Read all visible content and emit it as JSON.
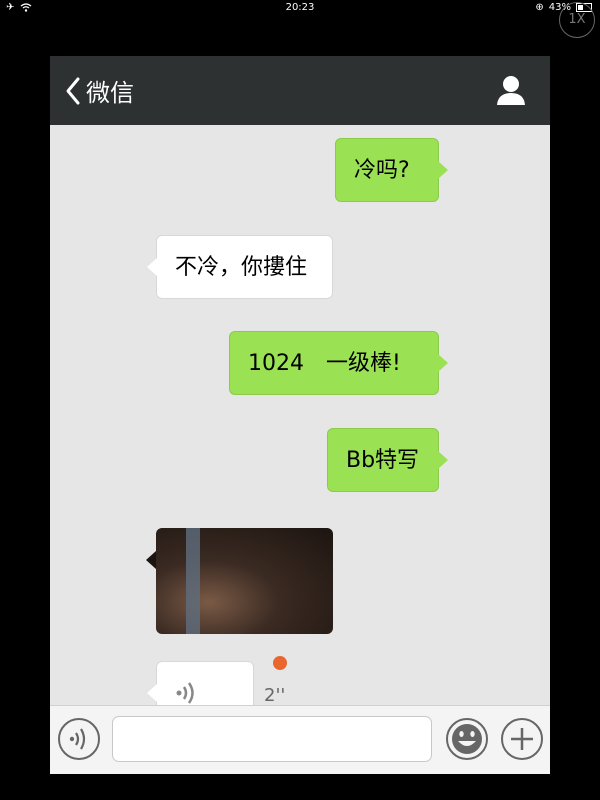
{
  "status_bar": {
    "time": "20:23",
    "battery": "43%",
    "airplane_icon": "airplane-icon",
    "wifi_icon": "wifi-icon",
    "orientation_lock_icon": "orientation-lock-icon",
    "zoom_badge": "1X"
  },
  "navbar": {
    "back_label": "微信",
    "back_icon": "chevron-left-icon",
    "profile_icon": "person-icon",
    "background": "#2e3132"
  },
  "messages": [
    {
      "direction": "outgoing",
      "text": "冷吗?"
    },
    {
      "direction": "incoming",
      "text": "不冷，你摟住"
    },
    {
      "direction": "outgoing",
      "text": "1024　一级棒!"
    },
    {
      "direction": "outgoing",
      "text": "Bb特写"
    },
    {
      "direction": "incoming",
      "type": "image"
    },
    {
      "direction": "incoming",
      "type": "voice",
      "duration": "2''",
      "unread": true
    }
  ],
  "colors": {
    "outgoing_bubble": "#9be154",
    "incoming_bubble": "#ffffff",
    "chat_background": "#e6e6e6",
    "unread_dot": "#e9662f"
  },
  "input_bar": {
    "voice_toggle_icon": "voice-wave-icon",
    "emoji_icon": "smiley-icon",
    "plus_icon": "plus-icon",
    "message_value": ""
  }
}
